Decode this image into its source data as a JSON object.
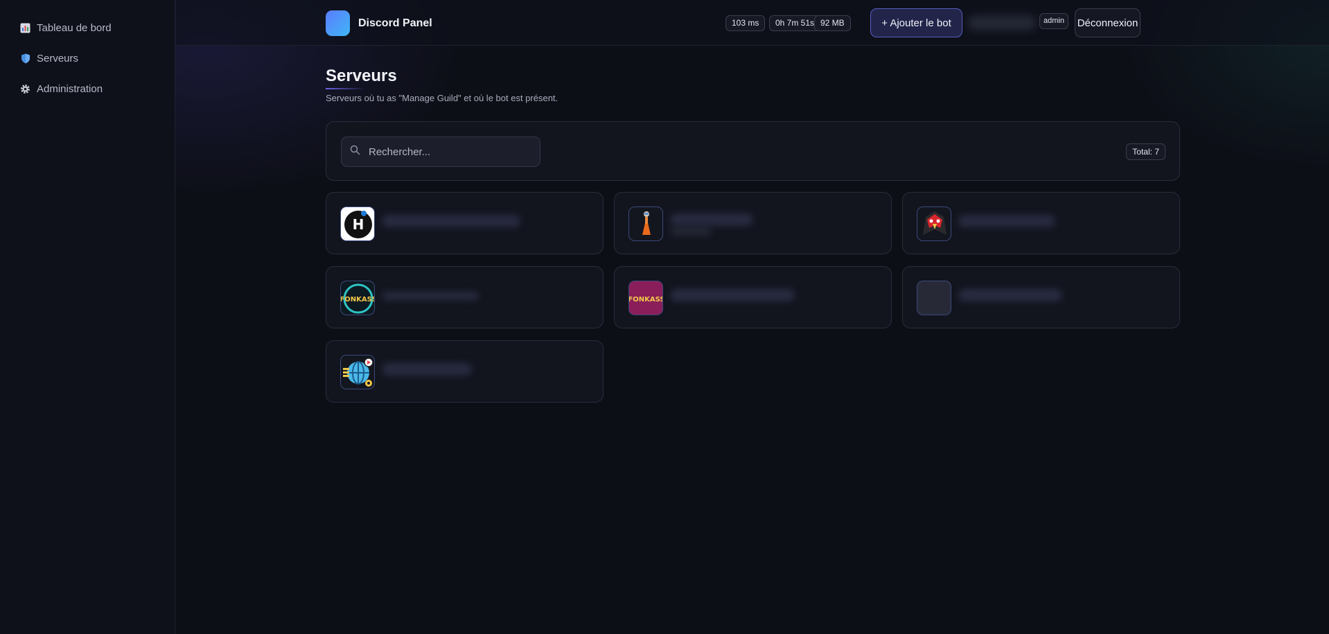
{
  "sidebar": {
    "items": [
      {
        "label": "Tableau de bord",
        "icon": "bar-chart-icon"
      },
      {
        "label": "Serveurs",
        "icon": "shield-icon"
      },
      {
        "label": "Administration",
        "icon": "gear-icon"
      }
    ]
  },
  "header": {
    "app_name": "Discord Panel",
    "stats": {
      "latency": "103 ms",
      "uptime": "0h 7m 51s",
      "memory": "92 MB"
    },
    "add_bot_label": "+ Ajouter le bot",
    "role": "admin",
    "logout_label": "Déconnexion"
  },
  "main": {
    "title": "Serveurs",
    "subtitle": "Serveurs où tu as \"Manage Guild\" et où le bot est présent.",
    "search": {
      "placeholder": "Rechercher...",
      "value": ""
    },
    "total_label": "Total: 7",
    "servers": [
      {
        "icon": "h-logo-icon",
        "name": ""
      },
      {
        "icon": "figure-icon",
        "name": ""
      },
      {
        "icon": "red-bird-icon",
        "name": ""
      },
      {
        "icon": "fonkass-ring-icon",
        "name": ""
      },
      {
        "icon": "fonkass-logo-icon",
        "name": ""
      },
      {
        "icon": "empty-avatar-icon",
        "name": ""
      },
      {
        "icon": "globe-icon",
        "name": ""
      }
    ]
  },
  "colors": {
    "background": "#0d0f17",
    "accent": "#5a5ec2",
    "brand_gradient_start": "#5b7cff",
    "brand_gradient_end": "#3fb6f5"
  }
}
